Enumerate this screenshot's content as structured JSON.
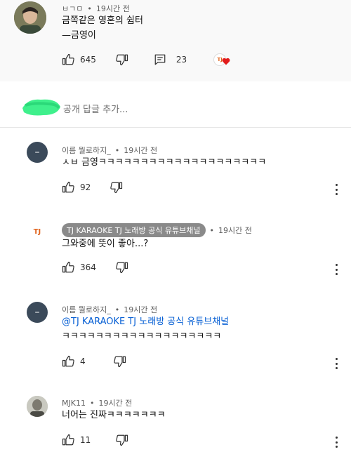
{
  "main_comment": {
    "author": "ㅂㄱㅁ",
    "time": "19시간 전",
    "line1": "금쪽같은 영혼의 쉼터",
    "line2": "—금영이",
    "likes": "645",
    "replies": "23",
    "hearted_by_badge": "TJ"
  },
  "reply_box": {
    "placeholder": "공개 답글 추가..."
  },
  "replies": [
    {
      "author": "이름 뭘로하지_",
      "time": "19시간 전",
      "text": "ㅅㅂ 금영ㅋㅋㅋㅋㅋㅋㅋㅋㅋㅋㅋㅋㅋㅋㅋㅋㅋㅋㅋㅋ",
      "likes": "92",
      "avatar_letter": "–"
    },
    {
      "author": "TJ KARAOKE TJ 노래방 공식 유튜브채널",
      "time": "19시간 전",
      "text": "그와중에 뜻이 좋아...?",
      "likes": "364",
      "avatar_text": "TJ"
    },
    {
      "author": "이름 뭘로하지_",
      "time": "19시간 전",
      "mention": "@TJ KARAOKE TJ 노래방 공식 유튜브채널",
      "text": "ㅋㅋㅋㅋㅋㅋㅋㅋㅋㅋㅋㅋㅋㅋㅋㅋㅋㅋㅋ",
      "likes": "4",
      "avatar_letter": "–"
    },
    {
      "author": "MJK11",
      "time": "19시간 전",
      "text": "너어는 진짜ㅋㅋㅋㅋㅋㅋㅋ",
      "likes": "11"
    }
  ],
  "colors": {
    "mention": "#065fd4",
    "chip": "#8a8a8a",
    "avatar_dark": "#3b4a5a",
    "heart": "#e21b1b"
  }
}
